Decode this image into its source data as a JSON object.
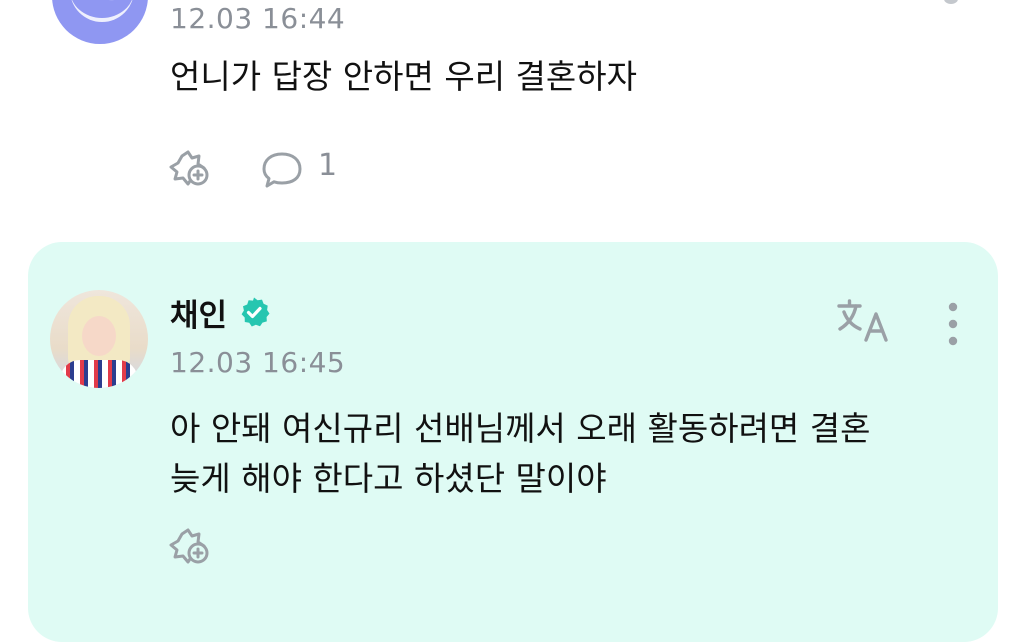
{
  "fan_comment": {
    "timestamp": "12.03 16:44",
    "text": "언니가 답장 안하면 우리 결혼하자",
    "reply_count": "1"
  },
  "artist_reply": {
    "author": "채인",
    "timestamp": "12.03 16:45",
    "text_line1": "아 안돼 여신규리 선배님께서 오래 활동하려면 결혼",
    "text_line2": "늦게 해야 한다고 하셨단 말이야"
  },
  "icons": {
    "reaction": "add-reaction-icon",
    "comment": "comment-bubble-icon",
    "verified": "verified-badge-icon",
    "translate": "translate-icon",
    "more": "more-vertical-icon"
  },
  "colors": {
    "card_background": "#dffbf4",
    "verified": "#26c6b0",
    "muted_text": "#8a8f97",
    "icon_gray": "#9aa0a6"
  }
}
